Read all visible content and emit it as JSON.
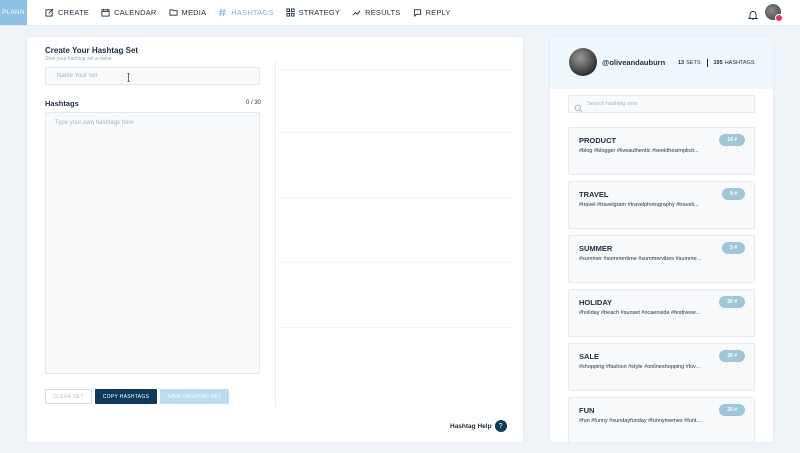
{
  "app": {
    "logo": "PLANN"
  },
  "nav": [
    {
      "label": "CREATE",
      "icon": "edit-icon",
      "active": false
    },
    {
      "label": "CALENDAR",
      "icon": "calendar-icon",
      "active": false
    },
    {
      "label": "MEDIA",
      "icon": "folder-icon",
      "active": false
    },
    {
      "label": "HASHTAGS",
      "icon": "hashtag-icon",
      "active": true
    },
    {
      "label": "STRATEGY",
      "icon": "grid-icon",
      "active": false
    },
    {
      "label": "RESULTS",
      "icon": "trend-icon",
      "active": false
    },
    {
      "label": "REPLY",
      "icon": "chat-icon",
      "active": false
    }
  ],
  "editor": {
    "title": "Create Your Hashtag Set",
    "subtitle": "Give your hashtag set a name",
    "name_placeholder": "Name Your Set",
    "name_value": "",
    "hashtags_label": "Hashtags",
    "count": "0 / 30",
    "hashtags_placeholder": "Type your own hashtags here",
    "hashtags_value": "",
    "clear_label": "CLEAR SET",
    "copy_label": "COPY HASHTAGS",
    "save_label": "SAVE HASHTAG SET",
    "help_label": "Hashtag Help",
    "help_icon": "?"
  },
  "profile": {
    "username": "@oliveandauburn",
    "sets_count": "13",
    "sets_label": "SETS",
    "hashtags_count": "195",
    "hashtags_label": "HASHTAGS"
  },
  "search": {
    "placeholder": "Search hashtag sets",
    "value": ""
  },
  "sets": [
    {
      "name": "PRODUCT",
      "tags": "#blog #blogger #liveauthentic #seekthesimplicit...",
      "count": "14 #"
    },
    {
      "name": "TRAVEL",
      "tags": "#travel #travelgram #travelphotography #traveli...",
      "count": "9 #"
    },
    {
      "name": "SUMMER",
      "tags": "#summer #summertime #summervibes #summe...",
      "count": "5 #"
    },
    {
      "name": "HOLIDAY",
      "tags": "#holiday #beach #sunset #ocaenside #festivese...",
      "count": "30 #"
    },
    {
      "name": "SALE",
      "tags": "#shopping #fashion #style #onlineshopping #lov...",
      "count": "30 #"
    },
    {
      "name": "FUN",
      "tags": "#fun #funny #sundayfunday #funnymemes #funt...",
      "count": "30 #"
    }
  ],
  "colors": {
    "accent_dark": "#0f3a5b",
    "accent_light": "#8ec1e3",
    "nav_active": "#7fb6d8",
    "badge": "#9fc6d8"
  }
}
